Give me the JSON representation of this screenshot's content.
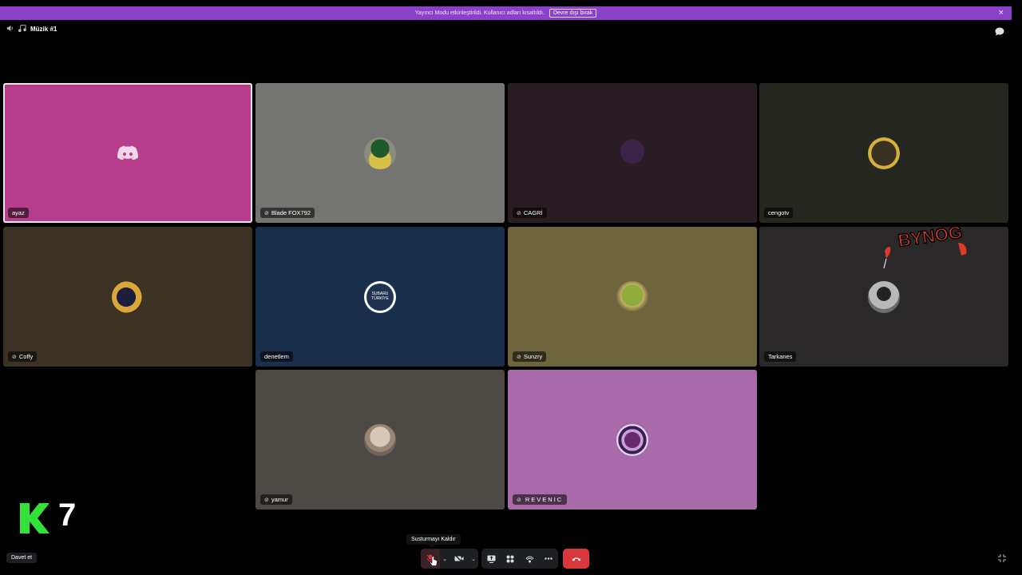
{
  "banner": {
    "message": "Yayıncı Modu etkinleştirildi. Kullanıcı adları kısaltıldı.",
    "button": "Devre dışı bırak",
    "close": "×"
  },
  "channel": {
    "name": "Müzik #1"
  },
  "tiles": [
    {
      "name": "ayaz",
      "muted": false,
      "color": "#b63e8c"
    },
    {
      "name": "Blade FOX792",
      "muted": true,
      "color": "#747572"
    },
    {
      "name": "CAGRİ",
      "muted": true,
      "color": "#291d24"
    },
    {
      "name": "cengotv",
      "muted": false,
      "color": "#252620"
    },
    {
      "name": "Coffy",
      "muted": false,
      "color": "#3b3224"
    },
    {
      "name": "denetlem",
      "muted": false,
      "color": "#1a2f4b"
    },
    {
      "name": "Sunzry",
      "muted": true,
      "color": "#6d653e"
    },
    {
      "name": "Tarkanes",
      "muted": false,
      "color": "#2a2828"
    },
    {
      "name": "yamur",
      "muted": true,
      "color": "#4d4945"
    },
    {
      "name": "REVENIC",
      "muted": true,
      "color": "#a86aa8"
    }
  ],
  "subaru_logo": {
    "line1": "SUBARU",
    "line2": "TÜRKİYE"
  },
  "sticker_text": "BYNOG",
  "logo_number": "7",
  "invite_button": "Davet et",
  "tooltip": "Susturmayı Kaldır",
  "colors": {
    "accent": "#8b40c9",
    "hangup": "#da373c"
  }
}
